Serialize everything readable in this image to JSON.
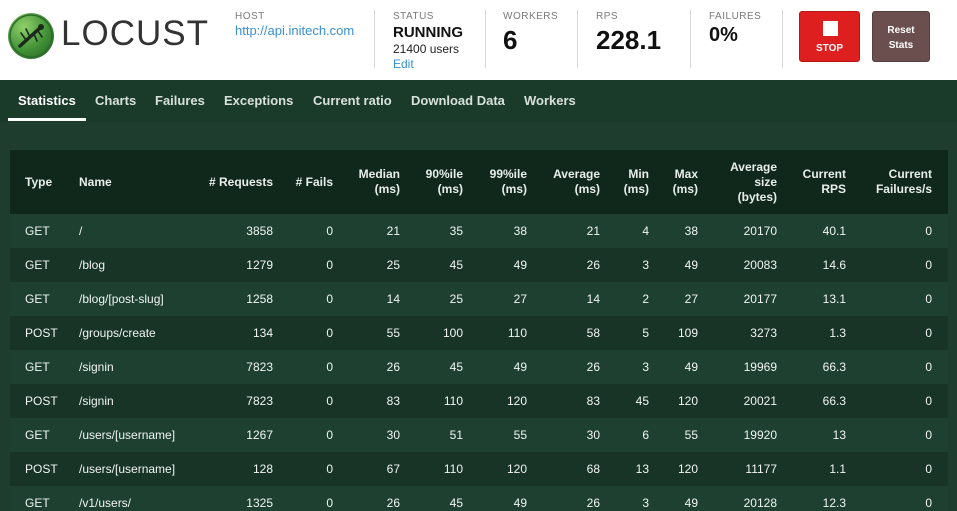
{
  "app": {
    "logo_text": "LOCUST"
  },
  "header": {
    "host": {
      "label": "HOST",
      "value": "http://api.initech.com"
    },
    "status": {
      "label": "STATUS",
      "value": "RUNNING",
      "users": "21400 users",
      "edit": "Edit"
    },
    "workers": {
      "label": "WORKERS",
      "value": "6"
    },
    "rps": {
      "label": "RPS",
      "value": "228.1"
    },
    "failures": {
      "label": "FAILURES",
      "value": "0%"
    },
    "stop_label": "STOP",
    "reset_label_line1": "Reset",
    "reset_label_line2": "Stats"
  },
  "tabs": [
    {
      "label": "Statistics",
      "active": true
    },
    {
      "label": "Charts"
    },
    {
      "label": "Failures"
    },
    {
      "label": "Exceptions"
    },
    {
      "label": "Current ratio"
    },
    {
      "label": "Download Data"
    },
    {
      "label": "Workers"
    }
  ],
  "table": {
    "headers": [
      [
        "Type"
      ],
      [
        "Name"
      ],
      [
        "# Requests"
      ],
      [
        "# Fails"
      ],
      [
        "Median",
        "(ms)"
      ],
      [
        "90%ile",
        "(ms)"
      ],
      [
        "99%ile",
        "(ms)"
      ],
      [
        "Average",
        "(ms)"
      ],
      [
        "Min",
        "(ms)"
      ],
      [
        "Max",
        "(ms)"
      ],
      [
        "Average",
        "size",
        "(bytes)"
      ],
      [
        "Current",
        "RPS"
      ],
      [
        "Current",
        "Failures/s"
      ]
    ],
    "rows": [
      [
        "GET",
        "/",
        "3858",
        "0",
        "21",
        "35",
        "38",
        "21",
        "4",
        "38",
        "20170",
        "40.1",
        "0"
      ],
      [
        "GET",
        "/blog",
        "1279",
        "0",
        "25",
        "45",
        "49",
        "26",
        "3",
        "49",
        "20083",
        "14.6",
        "0"
      ],
      [
        "GET",
        "/blog/[post-slug]",
        "1258",
        "0",
        "14",
        "25",
        "27",
        "14",
        "2",
        "27",
        "20177",
        "13.1",
        "0"
      ],
      [
        "POST",
        "/groups/create",
        "134",
        "0",
        "55",
        "100",
        "110",
        "58",
        "5",
        "109",
        "3273",
        "1.3",
        "0"
      ],
      [
        "GET",
        "/signin",
        "7823",
        "0",
        "26",
        "45",
        "49",
        "26",
        "3",
        "49",
        "19969",
        "66.3",
        "0"
      ],
      [
        "POST",
        "/signin",
        "7823",
        "0",
        "83",
        "110",
        "120",
        "83",
        "45",
        "120",
        "20021",
        "66.3",
        "0"
      ],
      [
        "GET",
        "/users/[username]",
        "1267",
        "0",
        "30",
        "51",
        "55",
        "30",
        "6",
        "55",
        "19920",
        "13",
        "0"
      ],
      [
        "POST",
        "/users/[username]",
        "128",
        "0",
        "67",
        "110",
        "120",
        "68",
        "13",
        "120",
        "11177",
        "1.1",
        "0"
      ],
      [
        "GET",
        "/v1/users/",
        "1325",
        "0",
        "26",
        "45",
        "49",
        "26",
        "3",
        "49",
        "20128",
        "12.3",
        "0"
      ]
    ]
  }
}
